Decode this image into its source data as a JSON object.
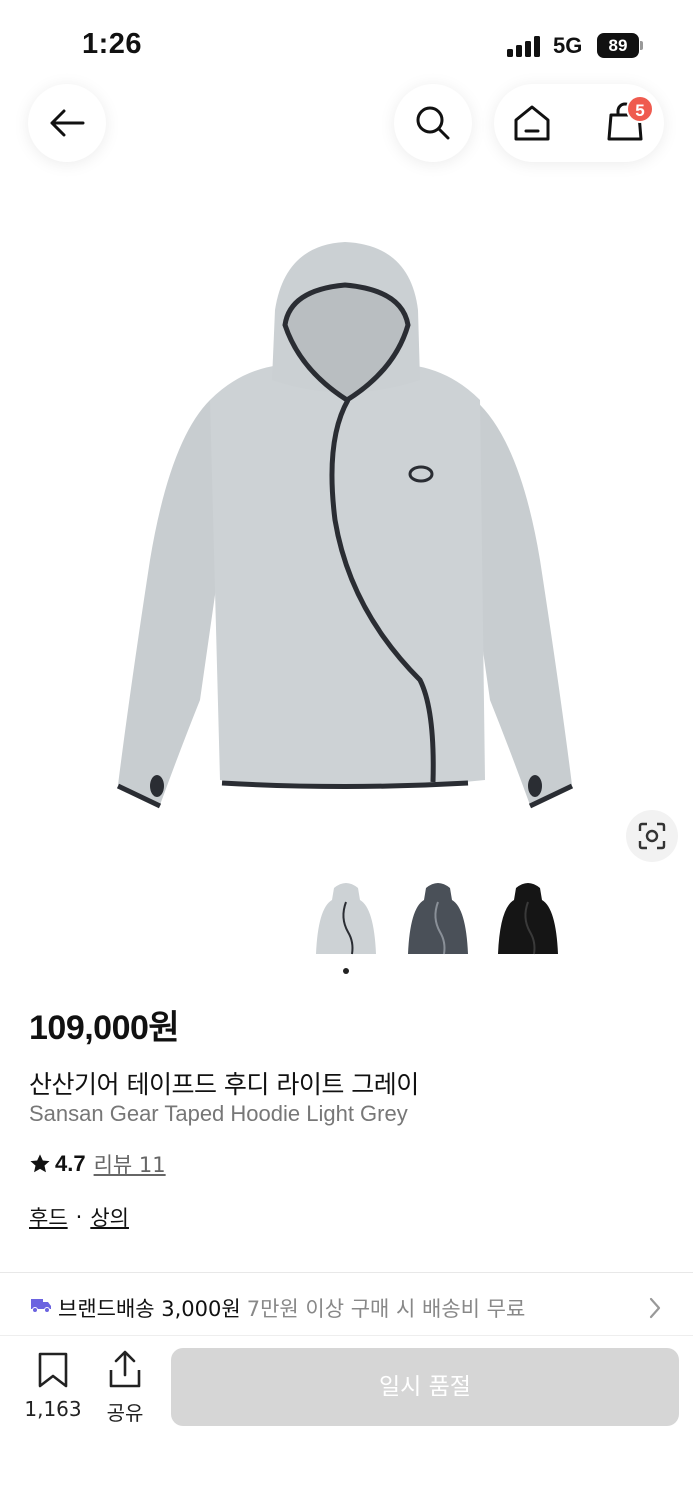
{
  "status_bar": {
    "time": "1:26",
    "network": "5G",
    "battery": "89"
  },
  "nav": {
    "back_icon": "arrow-left-icon",
    "search_icon": "search-icon",
    "home_icon": "home-icon",
    "cart_icon": "shopping-bag-icon",
    "cart_count": "5"
  },
  "gallery": {
    "colors": [
      "light-grey",
      "charcoal",
      "black"
    ],
    "selected_index": 0
  },
  "product": {
    "price": "109,000원",
    "name_ko": "산산기어 테이프드 후디 라이트 그레이",
    "name_en": "Sansan Gear Taped Hoodie Light Grey",
    "rating": "4.7",
    "review_label": "리뷰 11",
    "categories": [
      "후드",
      "상의"
    ],
    "category_sep": "·"
  },
  "shipping": {
    "label": "브랜드배송 3,000원",
    "note": "7만원 이상 구매 시 배송비 무료"
  },
  "bottom": {
    "save_count": "1,163",
    "share_label": "공유",
    "soldout_label": "일시 품절"
  },
  "colors": {
    "badge": "#ef5b4f",
    "button_disabled": "#d6d6d6",
    "truck": "#6b63e0"
  }
}
